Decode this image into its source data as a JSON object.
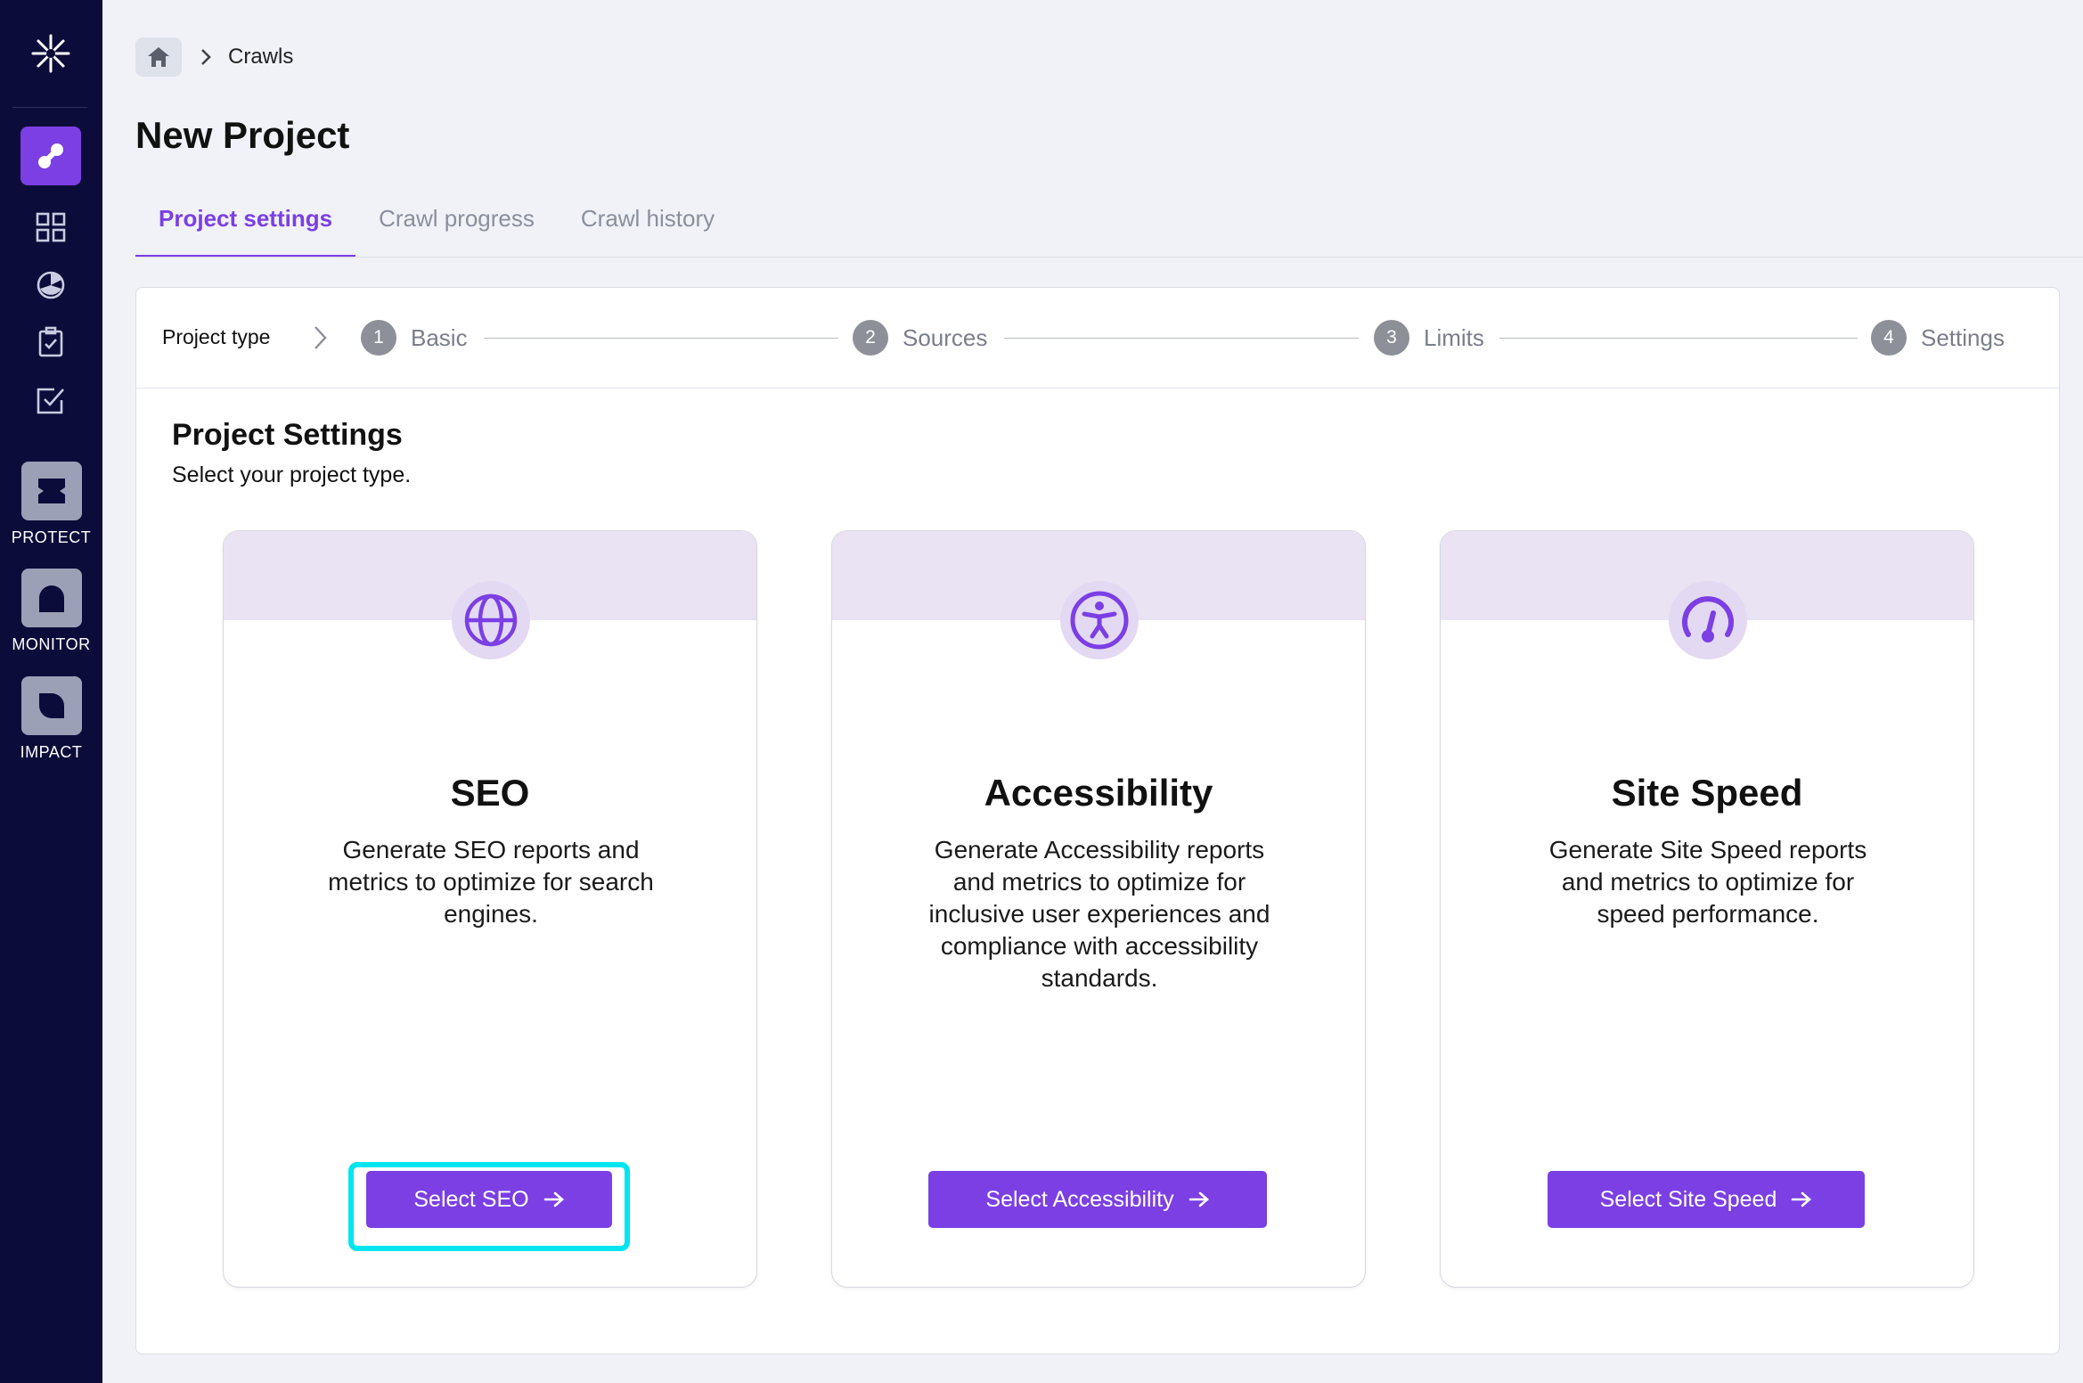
{
  "breadcrumb": {
    "current": "Crawls"
  },
  "page": {
    "title": "New Project"
  },
  "tabs": [
    {
      "label": "Project settings",
      "active": true
    },
    {
      "label": "Crawl progress",
      "active": false
    },
    {
      "label": "Crawl history",
      "active": false
    }
  ],
  "sidebar": {
    "products": [
      {
        "label": "PROTECT"
      },
      {
        "label": "MONITOR"
      },
      {
        "label": "IMPACT"
      }
    ]
  },
  "stepper": {
    "first": "Project type",
    "steps": [
      {
        "num": "1",
        "label": "Basic"
      },
      {
        "num": "2",
        "label": "Sources"
      },
      {
        "num": "3",
        "label": "Limits"
      },
      {
        "num": "4",
        "label": "Settings"
      }
    ]
  },
  "settings": {
    "title": "Project Settings",
    "subtitle": "Select your project type."
  },
  "types": [
    {
      "title": "SEO",
      "description": "Generate SEO reports and metrics to optimize for search engines.",
      "button": "Select SEO",
      "icon": "globe-icon"
    },
    {
      "title": "Accessibility",
      "description": "Generate Accessibility reports and metrics to optimize for inclusive user experiences and compliance with accessibility standards.",
      "button": "Select Accessibility",
      "icon": "accessibility-icon"
    },
    {
      "title": "Site Speed",
      "description": "Generate Site Speed reports and metrics to optimize for speed performance.",
      "button": "Select Site Speed",
      "icon": "speedometer-icon"
    }
  ],
  "colors": {
    "accent": "#7b3fe4",
    "sidebar": "#0c0c3a",
    "highlight": "#00e5f0"
  }
}
